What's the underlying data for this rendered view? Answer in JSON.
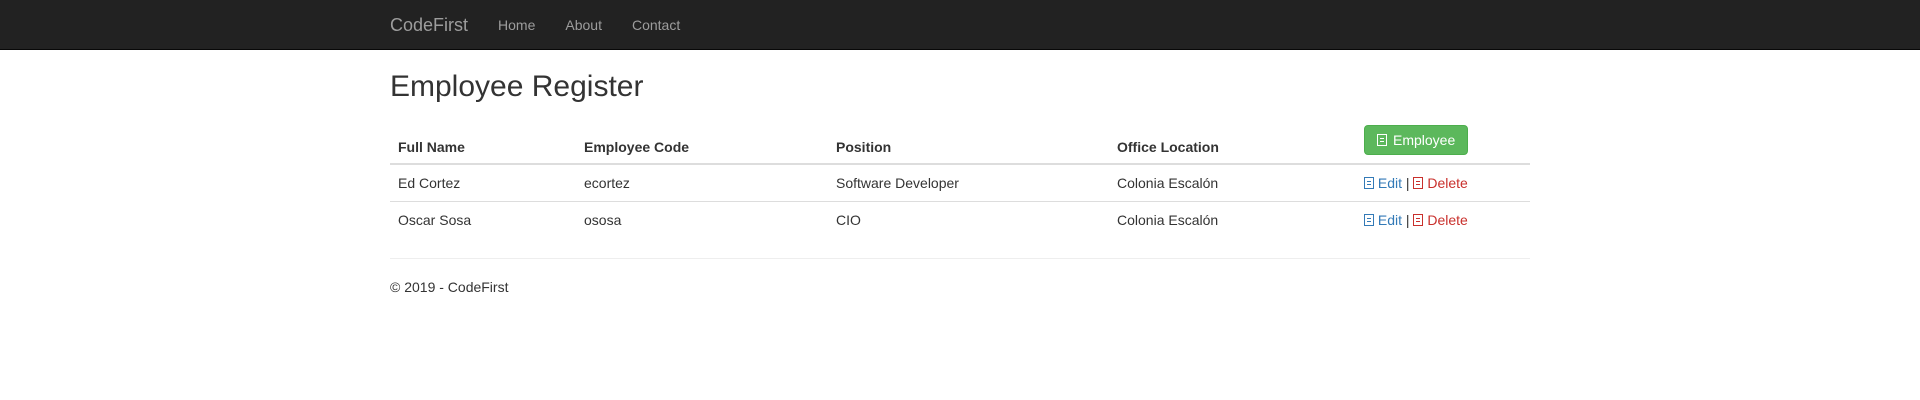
{
  "nav": {
    "brand": "CodeFirst",
    "links": [
      "Home",
      "About",
      "Contact"
    ]
  },
  "page": {
    "title": "Employee Register"
  },
  "table": {
    "headers": [
      "Full Name",
      "Employee Code",
      "Position",
      "Office Location"
    ],
    "add_button_label": "Employee",
    "rows": [
      {
        "full_name": "Ed Cortez",
        "code": "ecortez",
        "position": "Software Developer",
        "location": "Colonia Escalón"
      },
      {
        "full_name": "Oscar Sosa",
        "code": "ososa",
        "position": "CIO",
        "location": "Colonia Escalón"
      }
    ],
    "edit_label": "Edit",
    "separator": "|",
    "delete_label": "Delete"
  },
  "footer": {
    "text": "© 2019 - CodeFirst"
  },
  "icons": {
    "add": "add-icon",
    "edit": "edit-icon",
    "delete": "delete-icon"
  },
  "colors": {
    "navbar_bg": "#222222",
    "nav_text": "#9d9d9d",
    "add_button": "#5cb85c",
    "edit_link": "#337ab7",
    "delete_link": "#c9302c"
  }
}
